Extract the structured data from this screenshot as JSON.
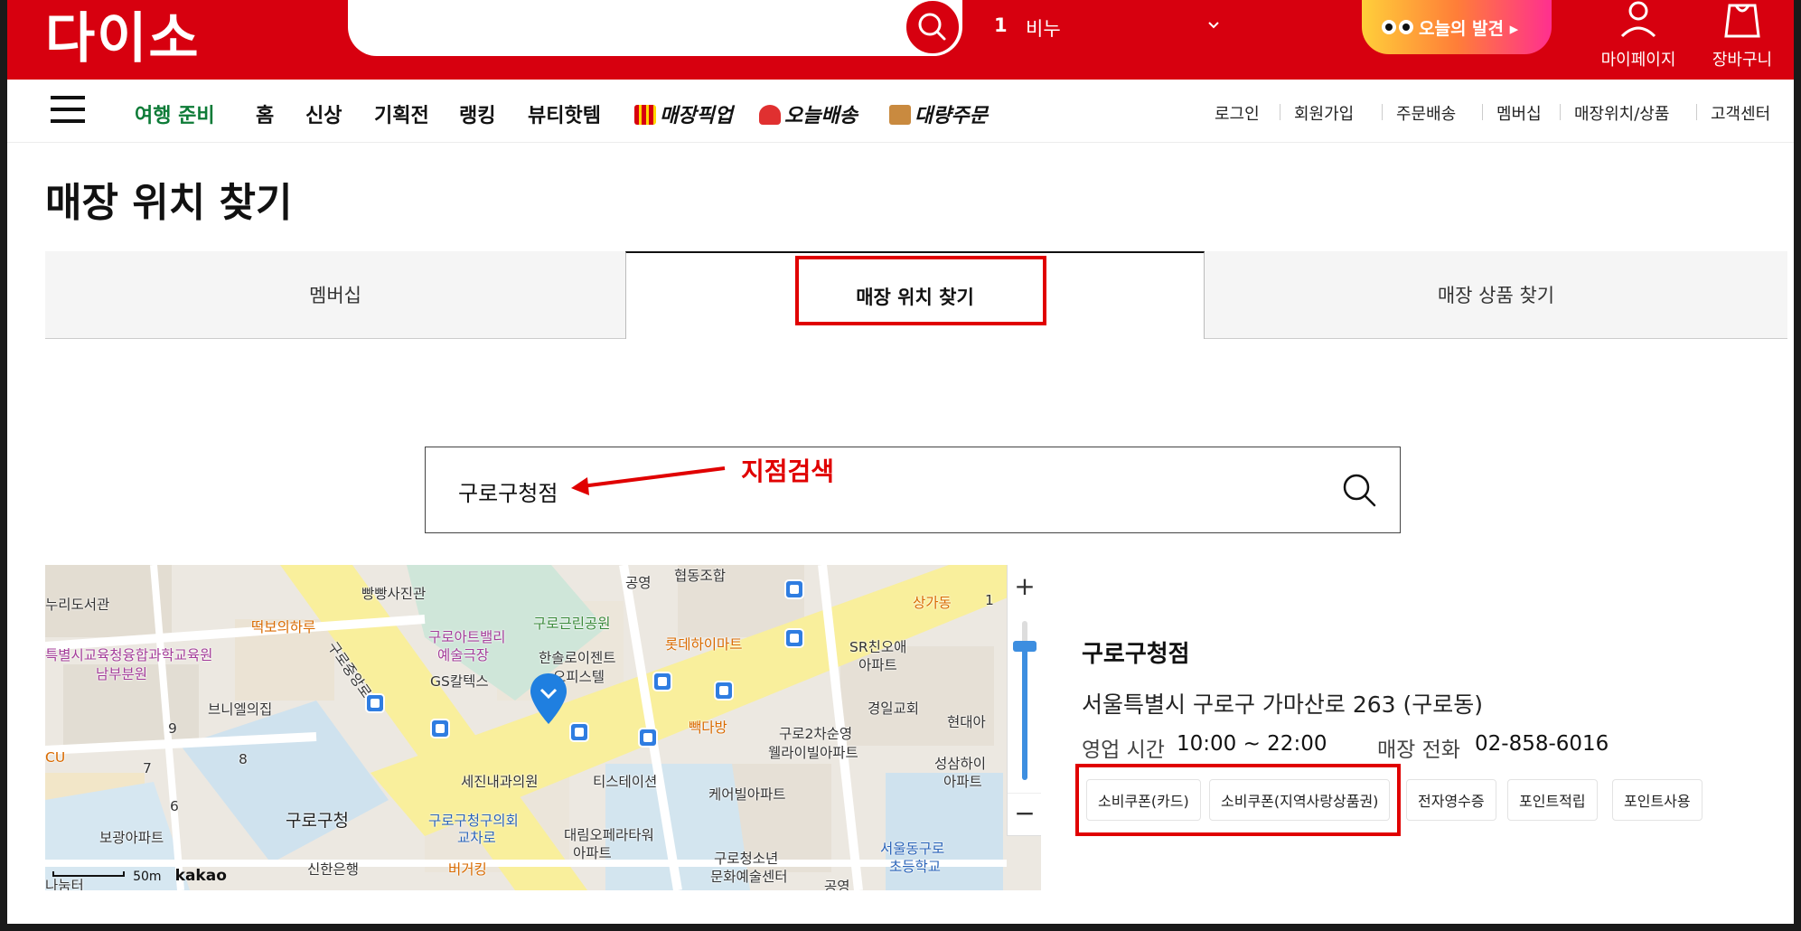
{
  "header": {
    "logo": "다이소",
    "search_placeholder": "",
    "rank_number": "1",
    "rank_keyword": "비누",
    "discover_label": "오늘의 발견 ▸",
    "mypage_label": "마이페이지",
    "cart_label": "장바구니",
    "brand_color": "#d7000f"
  },
  "nav": {
    "items": [
      "여행 준비",
      "홈",
      "신상",
      "기획전",
      "랭킹",
      "뷰티핫템",
      "매장픽업",
      "오늘배송",
      "대량주문"
    ],
    "utility": [
      "로그인",
      "회원가입",
      "주문배송",
      "멤버십",
      "매장위치/상품",
      "고객센터"
    ]
  },
  "page": {
    "title": "매장 위치 찾기"
  },
  "tabs": [
    {
      "label": "멤버십",
      "active": false
    },
    {
      "label": "매장 위치 찾기",
      "active": true
    },
    {
      "label": "매장 상품 찾기",
      "active": false
    }
  ],
  "store_search": {
    "value": "구로구청점"
  },
  "annotation": {
    "label": "지점검색",
    "color": "#e00000"
  },
  "map": {
    "labels": {
      "l1": "누리도서관",
      "l2": "빵빵사진관",
      "l3": "떡보의하루",
      "l4": "특별시교육청융합과학교육원",
      "l5": "남부분원",
      "l6": "구로아트밸리",
      "l7": "예술극장",
      "l8": "구로근린공원",
      "l9": "한솔로이젠트",
      "l10": "오피스텔",
      "l11": "GS칼텍스",
      "l12": "브니엘의집",
      "l13": "공영",
      "l14": "협동조합",
      "l15": "롯데하이마트",
      "l16": "SR친오애",
      "l17": "아파트",
      "l18": "상가동",
      "l19": "경일교회",
      "l20": "현대아",
      "l21": "빽다방",
      "l22": "구로2차순영",
      "l23": "웰라이빌아파트",
      "l24": "성삼하이",
      "l25": "아파트",
      "l26": "세진내과의원",
      "l27": "티스테이션",
      "l28": "케어빌아파트",
      "l29": "구로구청",
      "l30": "보광아파트",
      "l31": "구로구청구의회",
      "l32": "교차로",
      "l33": "대림오페라타워",
      "l34": "아파트",
      "l35": "신한은행",
      "l36": "버거킹",
      "l37": "구로청소년",
      "l38": "문화예술센터",
      "l39": "서울동구로",
      "l40": "초등학교",
      "l41": "공영",
      "l42": "구로중앙로",
      "l43": "나눔터",
      "l44": "CU"
    },
    "blocks": [
      "9",
      "7",
      "8",
      "6",
      "1"
    ],
    "zoom_in": "+",
    "zoom_out": "−",
    "scale_label": "50m",
    "provider": "kakao"
  },
  "store": {
    "name": "구로구청점",
    "address": "서울특별시 구로구 가마산로 263 (구로동)",
    "hours_label": "영업 시간",
    "hours": "10:00 ~ 22:00",
    "phone_label": "매장 전화",
    "phone": "02-858-6016",
    "services": [
      "소비쿠폰(카드)",
      "소비쿠폰(지역사랑상품권)",
      "전자영수증",
      "포인트적립",
      "포인트사용"
    ]
  }
}
